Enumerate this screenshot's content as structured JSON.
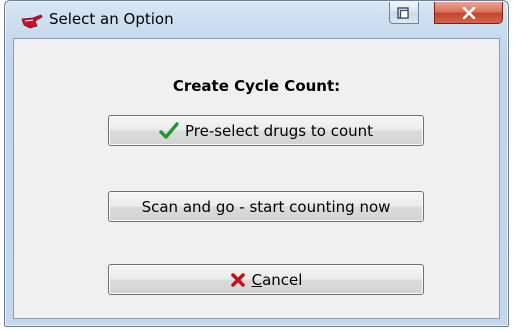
{
  "window": {
    "title": "Select an Option",
    "app_icon": "red-hand-pointer-icon",
    "controls": {
      "restore": "restore-icon",
      "close": "close-x-icon"
    }
  },
  "dialog": {
    "heading": "Create Cycle Count:",
    "buttons": {
      "preselect": {
        "label": "Pre-select drugs to count",
        "icon": "green-check-icon"
      },
      "scan": {
        "label": "Scan and go - start counting now"
      },
      "cancel": {
        "mnemonic": "C",
        "rest": "ancel",
        "icon": "red-x-icon"
      }
    }
  },
  "colors": {
    "check": "#1f9a2b",
    "cancel_x": "#c0141b",
    "close_button": "#c4452c"
  }
}
